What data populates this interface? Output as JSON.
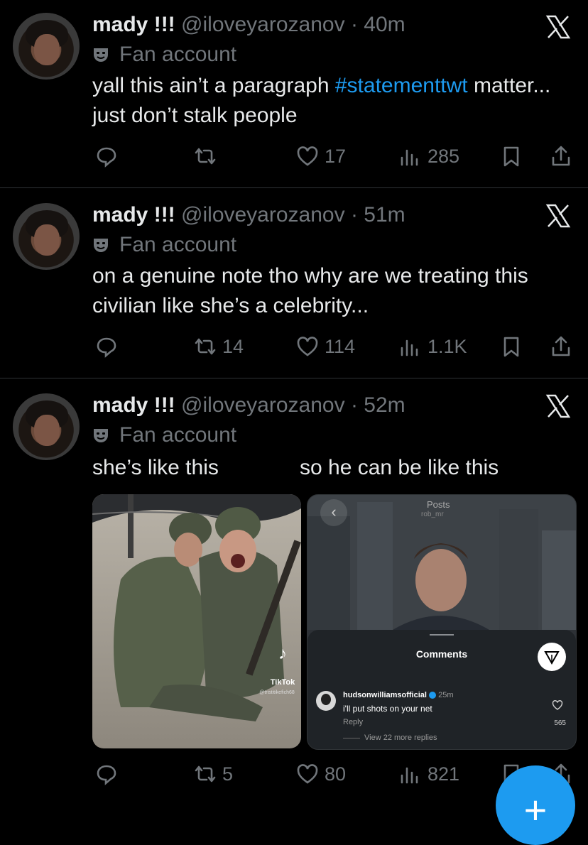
{
  "tweets": [
    {
      "name": "mady !!!",
      "handle": "@iloveyarozanov",
      "time": "40m",
      "badge": "Fan account",
      "text_before": "yall this ain’t a paragraph ",
      "hashtag": "#statementtwt",
      "text_after": " matter... just don’t stalk people",
      "replies": "",
      "retweets": "",
      "likes": "17",
      "views": "285"
    },
    {
      "name": "mady !!!",
      "handle": "@iloveyarozanov",
      "time": "51m",
      "badge": "Fan account",
      "text": "on a genuine note tho why are we treating this civilian like she’s a celebrity...",
      "replies": "",
      "retweets": "14",
      "likes": "114",
      "views": "1.1K"
    },
    {
      "name": "mady !!!",
      "handle": "@iloveyarozanov",
      "time": "52m",
      "badge": "Fan account",
      "text_left": "she’s like this",
      "text_right": "so he can be like this",
      "replies": "",
      "retweets": "5",
      "likes": "80",
      "views": "821"
    }
  ],
  "media_left": {
    "watermark": "TikTok",
    "username": "@tristitikefich68"
  },
  "media_right": {
    "posts_label": "Posts",
    "posts_user": "rob_mr",
    "comments_title": "Comments",
    "comment_user": "hudsonwilliamsofficial",
    "comment_time": "25m",
    "comment_text": "i'll put shots on your net",
    "reply_label": "Reply",
    "likes": "565",
    "view_more": "View 22 more replies"
  },
  "fab_label": "+",
  "colors": {
    "accent": "#1d9bf0",
    "muted": "#71767b",
    "text": "#e7e9ea",
    "bg": "#000000"
  }
}
